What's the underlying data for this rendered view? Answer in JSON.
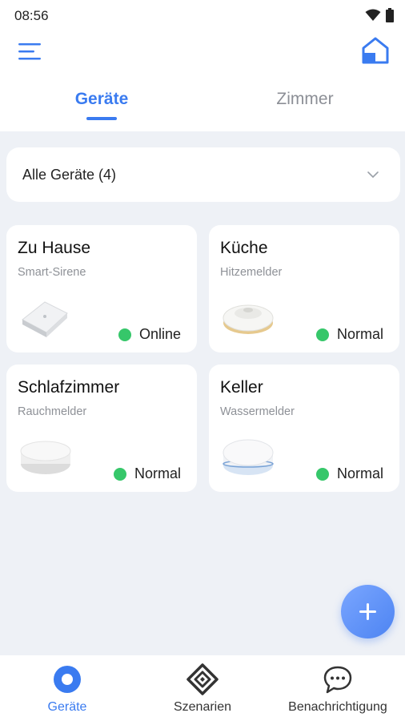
{
  "status_bar": {
    "time": "08:56",
    "icons": [
      "wifi-icon",
      "battery-icon"
    ]
  },
  "header": {
    "menu_icon": "hamburger-menu-icon",
    "home_icon": "home-icon"
  },
  "tabs": [
    {
      "label": "Geräte",
      "active": true
    },
    {
      "label": "Zimmer",
      "active": false
    }
  ],
  "filter": {
    "label": "Alle Geräte (4)",
    "icon": "chevron-down-icon"
  },
  "devices": [
    {
      "room": "Zu Hause",
      "type": "Smart-Sirene",
      "status": "Online",
      "status_color": "#36c76a",
      "image": "siren-device-image"
    },
    {
      "room": "Küche",
      "type": "Hitzemelder",
      "status": "Normal",
      "status_color": "#36c76a",
      "image": "heat-detector-image"
    },
    {
      "room": "Schlafzimmer",
      "type": "Rauchmelder",
      "status": "Normal",
      "status_color": "#36c76a",
      "image": "smoke-detector-image"
    },
    {
      "room": "Keller",
      "type": "Wassermelder",
      "status": "Normal",
      "status_color": "#36c76a",
      "image": "water-sensor-image"
    }
  ],
  "fab": {
    "icon": "plus-icon"
  },
  "bottom_nav": [
    {
      "label": "Geräte",
      "icon": "devices-icon",
      "active": true
    },
    {
      "label": "Szenarien",
      "icon": "scenes-icon",
      "active": false
    },
    {
      "label": "Benachrichtigung",
      "icon": "chat-bubble-icon",
      "active": false
    }
  ],
  "colors": {
    "accent": "#3a7bf0",
    "background": "#eef1f6",
    "online": "#36c76a"
  }
}
